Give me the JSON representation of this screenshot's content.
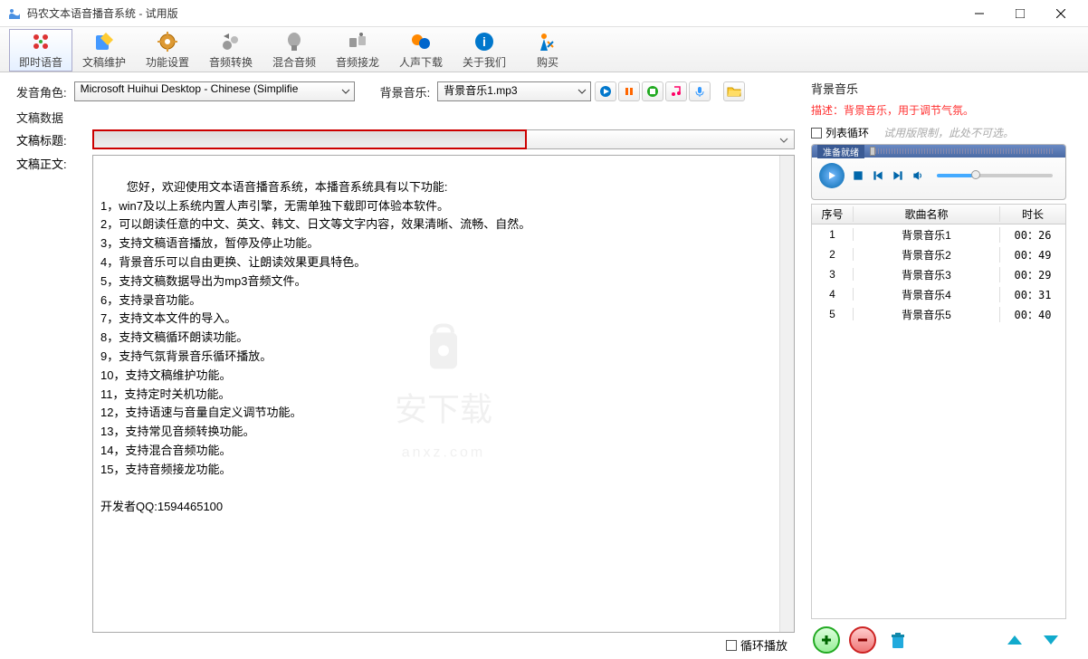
{
  "window": {
    "title": "码农文本语音播音系统 - 试用版"
  },
  "toolbar": {
    "items": [
      {
        "label": "即时语音",
        "icon": "voice"
      },
      {
        "label": "文稿维护",
        "icon": "edit"
      },
      {
        "label": "功能设置",
        "icon": "gear"
      },
      {
        "label": "音频转换",
        "icon": "convert"
      },
      {
        "label": "混合音频",
        "icon": "mix"
      },
      {
        "label": "音频接龙",
        "icon": "chain"
      },
      {
        "label": "人声下载",
        "icon": "download"
      },
      {
        "label": "关于我们",
        "icon": "about"
      },
      {
        "label": "购买",
        "icon": "buy"
      }
    ]
  },
  "left": {
    "voice_label": "发音角色:",
    "voice_value": "Microsoft Huihui Desktop - Chinese (Simplifie",
    "bgm_label": "背景音乐:",
    "bgm_value": "背景音乐1.mp3",
    "data_label": "文稿数据",
    "title_label": "文稿标题:",
    "title_value": "",
    "body_label": "文稿正文:",
    "body_text": "您好，欢迎使用文本语音播音系统，本播音系统具有以下功能:\n1，win7及以上系统内置人声引擎，无需单独下载即可体验本软件。\n2，可以朗读任意的中文、英文、韩文、日文等文字内容，效果清晰、流畅、自然。\n3，支持文稿语音播放，暂停及停止功能。\n4，背景音乐可以自由更换、让朗读效果更具特色。\n5，支持文稿数据导出为mp3音频文件。\n6，支持录音功能。\n7，支持文本文件的导入。\n8，支持文稿循环朗读功能。\n9，支持气氛背景音乐循环播放。\n10，支持文稿维护功能。\n11，支持定时关机功能。\n12，支持语速与音量自定义调节功能。\n13，支持常见音频转换功能。\n14，支持混合音频功能。\n15，支持音频接龙功能。\n\n开发者QQ:1594465100",
    "loop_label": "循环播放"
  },
  "right": {
    "title": "背景音乐",
    "desc": "描述：背景音乐，用于调节气氛。",
    "loop_label": "列表循环",
    "loop_hint": "试用版限制，此处不可选。",
    "player_status": "准备就绪",
    "table": {
      "h_idx": "序号",
      "h_name": "歌曲名称",
      "h_dur": "时长",
      "rows": [
        {
          "idx": "1",
          "name": "背景音乐1",
          "dur": "00：26"
        },
        {
          "idx": "2",
          "name": "背景音乐2",
          "dur": "00：49"
        },
        {
          "idx": "3",
          "name": "背景音乐3",
          "dur": "00：29"
        },
        {
          "idx": "4",
          "name": "背景音乐4",
          "dur": "00：31"
        },
        {
          "idx": "5",
          "name": "背景音乐5",
          "dur": "00：40"
        }
      ]
    }
  },
  "watermark": {
    "main": "安下载",
    "sub": "anxz.com"
  }
}
